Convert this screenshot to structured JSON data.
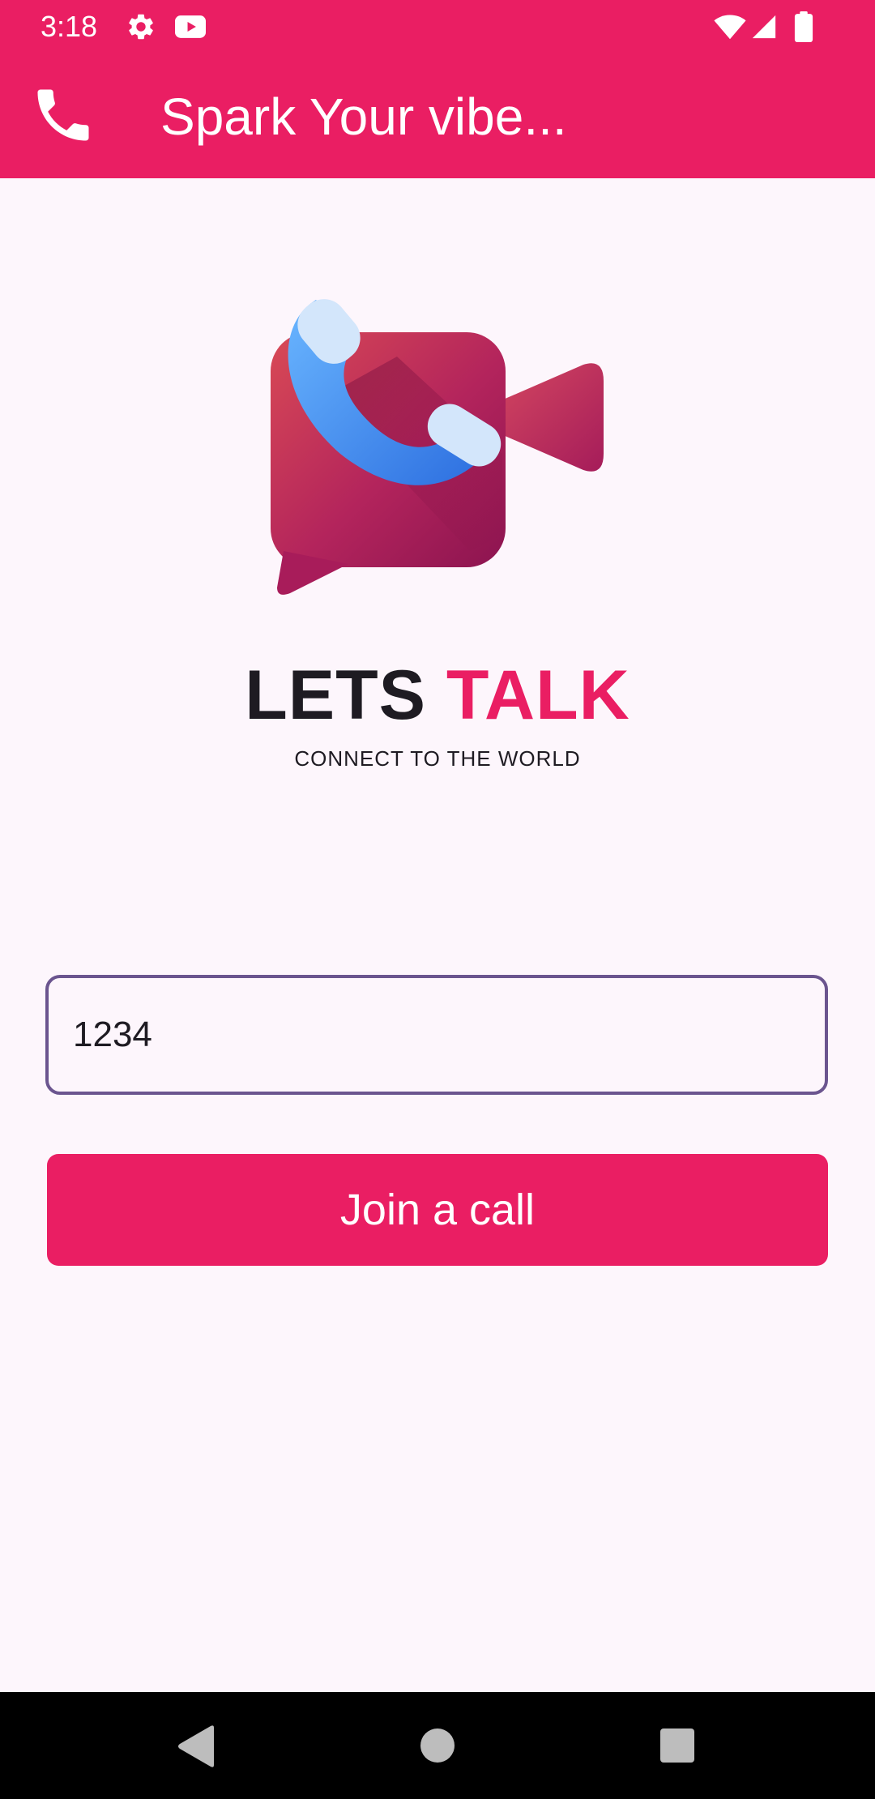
{
  "status_bar": {
    "time": "3:18",
    "icons": [
      "gear-icon",
      "youtube-icon",
      "wifi-icon",
      "signal-icon",
      "battery-icon"
    ]
  },
  "app_bar": {
    "icon": "phone-icon",
    "title": "Spark Your vibe..."
  },
  "hero": {
    "logo": "video-call-logo",
    "brand_part1": "LETS",
    "brand_part2": "TALK",
    "tagline": "CONNECT TO THE WORLD"
  },
  "form": {
    "call_code_value": "1234",
    "join_button_label": "Join a call"
  },
  "navigation_bar": {
    "icons": [
      "back-icon",
      "home-icon",
      "recents-icon"
    ]
  },
  "colors": {
    "accent": "#ea1e63",
    "background": "#fdf6fc",
    "field_border": "#6b558f",
    "text": "#1e1b22"
  }
}
